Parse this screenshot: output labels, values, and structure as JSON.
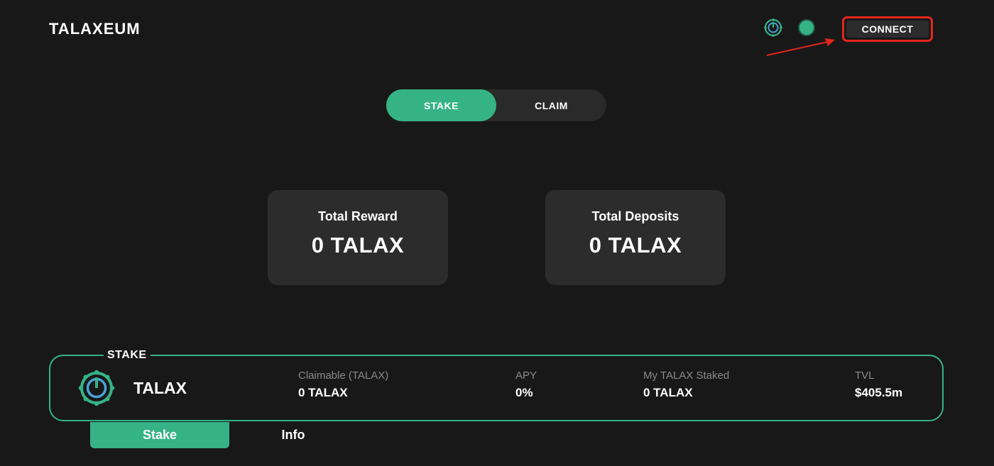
{
  "header": {
    "brand": "TALAXEUM",
    "connect_label": "CONNECT"
  },
  "toggle": {
    "stake_label": "STAKE",
    "claim_label": "CLAIM",
    "active": "STAKE"
  },
  "stats": {
    "reward_label": "Total Reward",
    "reward_value": "0 TALAX",
    "deposits_label": "Total Deposits",
    "deposits_value": "0 TALAX"
  },
  "pool": {
    "section_tag": "STAKE",
    "token_name": "TALAX",
    "metrics": [
      {
        "label": "Claimable (TALAX)",
        "value": "0 TALAX"
      },
      {
        "label": "APY",
        "value": "0%"
      },
      {
        "label": "My TALAX Staked",
        "value": "0 TALAX"
      },
      {
        "label": "TVL",
        "value": "$405.5m"
      }
    ]
  },
  "tabs": [
    {
      "label": "Stake",
      "active": true
    },
    {
      "label": "Info",
      "active": false
    }
  ],
  "icons": {
    "token_icon": "talax-token-icon",
    "status_icon": "network-status-icon"
  },
  "colors": {
    "accent": "#36b386",
    "background": "#181818",
    "card": "#2c2c2c",
    "annotation": "#e2261b"
  }
}
